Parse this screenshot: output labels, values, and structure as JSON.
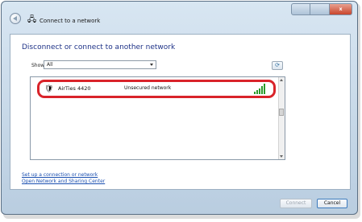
{
  "window": {
    "title": "Connect to a network",
    "caption_buttons": {
      "close": "x"
    }
  },
  "main": {
    "heading": "Disconnect or connect to another network",
    "show_label": "Show",
    "show_value": "All"
  },
  "networks": [
    {
      "name": "AirTies 4420",
      "security": "Unsecured network",
      "signal_bars": 5
    }
  ],
  "links": {
    "setup": "Set up a connection or network",
    "sharing_center": "Open Network and Sharing Center"
  },
  "buttons": {
    "connect": "Connect",
    "cancel": "Cancel"
  },
  "colors": {
    "highlight": "#d9232a",
    "heading": "#1e3287",
    "link": "#1a4fb0",
    "signal": "#2a9a2a"
  }
}
